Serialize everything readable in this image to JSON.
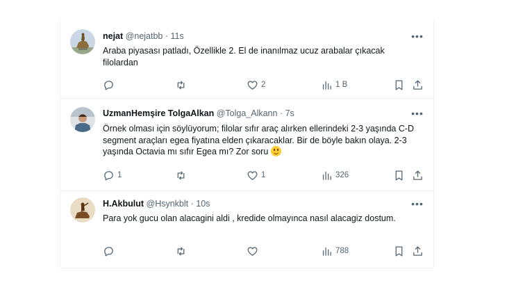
{
  "tweets": [
    {
      "name": "nejat",
      "handle": "@nejatbb",
      "dot": "·",
      "time": "11s",
      "text": "Araba piyasası patladı, Özellikle 2. El de inanılmaz ucuz arabalar çıkacak filolardan",
      "avatar": "statue-avatar",
      "reply_count": "",
      "retweet_count": "",
      "like_count": "2",
      "view_count": "1 B"
    },
    {
      "name": "UzmanHemşire TolgaAlkan",
      "handle": "@Tolga_Alkann",
      "dot": "·",
      "time": "7s",
      "text": "Örnek olması için söylüyorum; filolar sıfır araç alırken ellerindeki 2-3 yaşında C-D segment araçları egea fiyatına elden çıkaracaklar. Bir de böyle bakın olaya. 2-3 yaşında Octavia mı sıfır Egea mı? Zor soru",
      "emoji": "smiling-face-emoji",
      "avatar": "person-avatar",
      "reply_count": "1",
      "retweet_count": "",
      "like_count": "1",
      "view_count": "326"
    },
    {
      "name": "H.Akbulut",
      "handle": "@Hsynkblt",
      "dot": "·",
      "time": "10s",
      "text": "Para yok gucu olan alacagini aldi , kredide olmayınca  nasıl alacagiz dostum.",
      "avatar": "rider-avatar",
      "reply_count": "",
      "retweet_count": "",
      "like_count": "",
      "view_count": "788"
    }
  ],
  "colors": {
    "text": "#0f1419",
    "muted": "#536471",
    "divider": "#eff3f4",
    "emoji": "#ffcc33"
  }
}
